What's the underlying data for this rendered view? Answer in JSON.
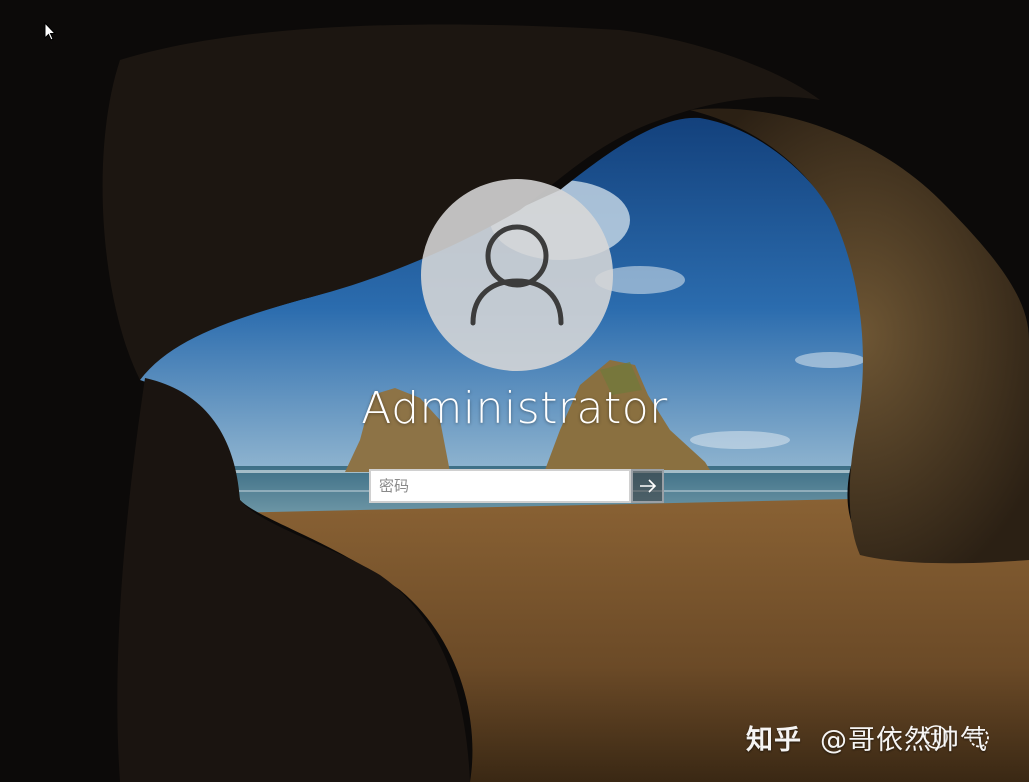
{
  "login": {
    "username": "Administrator",
    "password_placeholder": "密码",
    "password_value": ""
  },
  "icons": {
    "avatar": "user-silhouette-icon",
    "submit": "arrow-right-icon",
    "cursor": "mouse-pointer-icon",
    "accessibility": "ease-of-access-icon",
    "power": "power-icon"
  },
  "watermark": {
    "brand": "知乎",
    "handle": "@哥依然帅气"
  },
  "colors": {
    "sky": "#1f5fa3",
    "sand": "#6a4a28",
    "cave": "#0b0908",
    "avatar_bg": "#d7d7d7"
  }
}
